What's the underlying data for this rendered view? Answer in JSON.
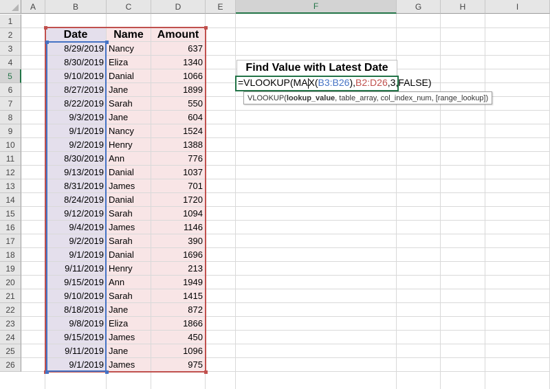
{
  "columns": [
    "A",
    "B",
    "C",
    "D",
    "E",
    "F",
    "G",
    "H",
    "I"
  ],
  "active_column": "F",
  "rows": [
    "1",
    "2",
    "3",
    "4",
    "5",
    "6",
    "7",
    "8",
    "9",
    "10",
    "11",
    "12",
    "13",
    "14",
    "15",
    "16",
    "17",
    "18",
    "19",
    "20",
    "21",
    "22",
    "23",
    "24",
    "25",
    "26"
  ],
  "active_row": "5",
  "table": {
    "headers": [
      "Date",
      "Name",
      "Amount"
    ],
    "data": [
      [
        "8/29/2019",
        "Nancy",
        "637"
      ],
      [
        "8/30/2019",
        "Eliza",
        "1340"
      ],
      [
        "9/10/2019",
        "Danial",
        "1066"
      ],
      [
        "8/27/2019",
        "Jane",
        "1899"
      ],
      [
        "8/22/2019",
        "Sarah",
        "550"
      ],
      [
        "9/3/2019",
        "Jane",
        "604"
      ],
      [
        "9/1/2019",
        "Nancy",
        "1524"
      ],
      [
        "9/2/2019",
        "Henry",
        "1388"
      ],
      [
        "8/30/2019",
        "Ann",
        "776"
      ],
      [
        "9/13/2019",
        "Danial",
        "1037"
      ],
      [
        "8/31/2019",
        "James",
        "701"
      ],
      [
        "8/24/2019",
        "Danial",
        "1720"
      ],
      [
        "9/12/2019",
        "Sarah",
        "1094"
      ],
      [
        "9/4/2019",
        "James",
        "1146"
      ],
      [
        "9/2/2019",
        "Sarah",
        "390"
      ],
      [
        "9/1/2019",
        "Danial",
        "1696"
      ],
      [
        "9/11/2019",
        "Henry",
        "213"
      ],
      [
        "9/15/2019",
        "Ann",
        "1949"
      ],
      [
        "9/10/2019",
        "Sarah",
        "1415"
      ],
      [
        "8/18/2019",
        "Jane",
        "872"
      ],
      [
        "9/8/2019",
        "Eliza",
        "1866"
      ],
      [
        "9/15/2019",
        "James",
        "450"
      ],
      [
        "9/11/2019",
        "Jane",
        "1096"
      ],
      [
        "9/1/2019",
        "James",
        "975"
      ]
    ]
  },
  "title_cell": "Find Value with Latest Date",
  "formula": {
    "part1": "=VLOOKUP(MA",
    "part2": "X(",
    "range1": "B3:B26",
    "part3": "),",
    "range2": "B2:D26",
    "part4": ",3,FALSE)"
  },
  "tooltip": {
    "fn": "VLOOKUP(",
    "arg1": "lookup_value",
    "rest": ", table_array, col_index_num, [range_lookup])"
  },
  "colors": {
    "range1": "#4472c4",
    "range2": "#c0504d",
    "accent": "#217346"
  }
}
